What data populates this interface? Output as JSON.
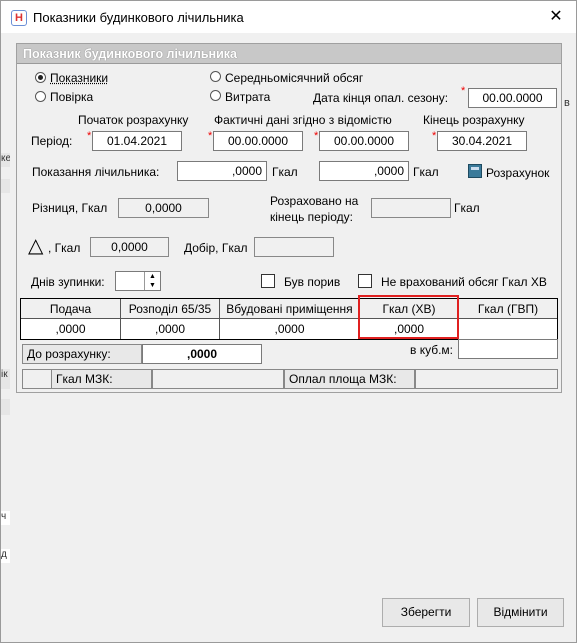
{
  "window": {
    "title": "Показники будинкового лічильника",
    "close_glyph": "✕",
    "app_icon_letter": "Н"
  },
  "panel": {
    "header": "Показник будинкового лічильника"
  },
  "mode": {
    "option_readings": "Показники",
    "option_verification": "Повірка",
    "option_monthly_avg": "Середньомісячний обсяг",
    "option_consumption": "Витрата",
    "selected": "Показники"
  },
  "season_end": {
    "label": "Дата кінця опал. сезону:",
    "value": "00.00.0000"
  },
  "period": {
    "label": "Період:",
    "start_header": "Початок розрахунку",
    "start_value": "01.04.2021",
    "actual_header": "Фактичні дані згідно з відомістю",
    "actual_from": "00.00.0000",
    "actual_to": "00.00.0000",
    "end_header": "Кінець розрахунку",
    "end_value": "30.04.2021"
  },
  "meter": {
    "label": "Показання лічильника:",
    "value_start": ",0000",
    "unit_start": "Гкал",
    "value_end": ",0000",
    "unit_end": "Гкал",
    "calc_button": "Розрахунок"
  },
  "difference": {
    "label": "Різниця, Гкал",
    "value": "0,0000"
  },
  "computed_end": {
    "label_line1": "Розраховано на",
    "label_line2": "кінець періоду:",
    "value": "",
    "unit": "Гкал"
  },
  "delta": {
    "symbol": "△",
    "label": ", Гкал",
    "value": "0,0000"
  },
  "addition": {
    "label": "Добір, Гкал",
    "value": ""
  },
  "stop_days": {
    "label": "Днів зупинки:",
    "value": ""
  },
  "checks": {
    "rupture": "Був порив",
    "not_counted": "Не врахований обсяг Гкал ХВ"
  },
  "table": {
    "headers": [
      "Подача",
      "Розподіл 65/35",
      "Вбудовані приміщення",
      "Гкал (ХВ)",
      "Гкал (ГВП)"
    ],
    "values": [
      ",0000",
      ",0000",
      ",0000",
      ",0000",
      ""
    ]
  },
  "cubic_label": "в куб.м:",
  "cubic_value": "",
  "to_calc": {
    "label": "До розрахунку:",
    "value": ",0000"
  },
  "mzk": {
    "gcal_label": "Гкал МЗК:",
    "gcal_value": "",
    "area_label": "Оплал площа МЗК:",
    "area_value": ""
  },
  "buttons": {
    "save": "Зберегти",
    "cancel": "Відмінити"
  },
  "background_fragments": [
    "ке",
    "в",
    "ік",
    "ч",
    "д"
  ]
}
